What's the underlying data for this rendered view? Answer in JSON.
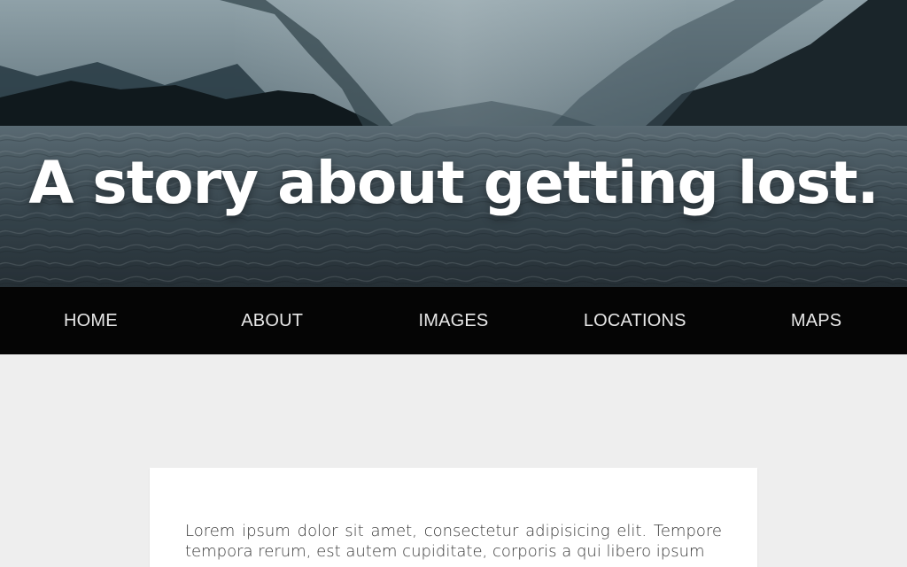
{
  "hero": {
    "title": "A story about getting lost."
  },
  "nav": {
    "items": [
      {
        "label": "HOME"
      },
      {
        "label": "ABOUT"
      },
      {
        "label": "IMAGES"
      },
      {
        "label": "LOCATIONS"
      },
      {
        "label": "MAPS"
      }
    ]
  },
  "main": {
    "paragraph": "Lorem ipsum dolor sit amet, consectetur adipisicing elit. Tempore tempora rerum, est autem cupiditate, corporis a qui libero ipsum"
  },
  "colors": {
    "nav_background": "#050505",
    "page_background": "#eeeeee",
    "card_background": "#ffffff",
    "title_text": "#ffffff"
  }
}
